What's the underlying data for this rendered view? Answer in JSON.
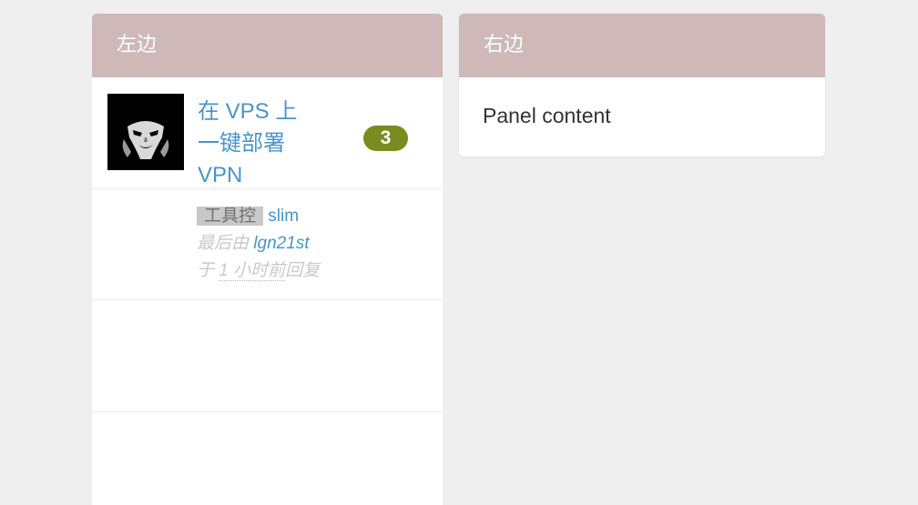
{
  "left_panel": {
    "title": "左边",
    "topic": {
      "title": "在 VPS 上一键部署 VPN",
      "reply_count": "3",
      "node": "工具控",
      "author": "slim",
      "last_reply_prefix": "最后由 ",
      "last_reply_user": "lgn21st",
      "last_reply_in": " 于 ",
      "time_ago": "1 小时前",
      "last_reply_suffix": "回复"
    }
  },
  "right_panel": {
    "title": "右边",
    "content": "Panel content"
  },
  "colors": {
    "page_background": "#efefef",
    "panel_header": "#cfb8b8",
    "link": "#4a94c8",
    "badge": "#7a8c1f"
  }
}
